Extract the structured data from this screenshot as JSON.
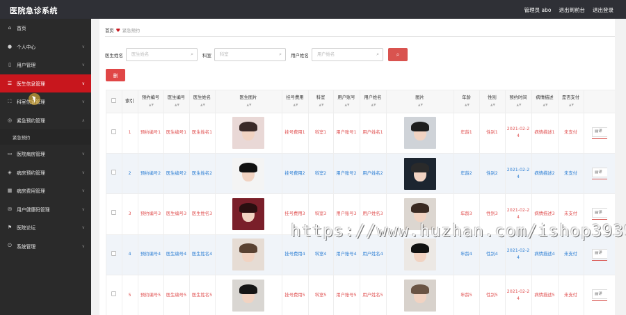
{
  "header": {
    "title": "医院急诊系统",
    "user": "管理员 abo",
    "backstage": "退出到前台",
    "logout": "退出登录"
  },
  "sidebar": {
    "items": [
      {
        "label": "首页",
        "icon": "home-icon"
      },
      {
        "label": "个人中心",
        "icon": "user-icon"
      },
      {
        "label": "用户管理",
        "icon": "phone-icon"
      },
      {
        "label": "医生信息管理",
        "icon": "list-icon"
      },
      {
        "label": "科室信息管理",
        "icon": "expand-icon"
      },
      {
        "label": "紧急预约管理",
        "icon": "compass-icon"
      },
      {
        "label": "医院病房管理",
        "icon": "card-icon"
      },
      {
        "label": "病房预约管理",
        "icon": "tag-icon"
      },
      {
        "label": "病房费用管理",
        "icon": "grid-icon"
      },
      {
        "label": "用户健康码管理",
        "icon": "mail-icon"
      },
      {
        "label": "医院论坛",
        "icon": "flag-icon"
      },
      {
        "label": "系统管理",
        "icon": "power-icon"
      }
    ],
    "sub_item": "紧急预约"
  },
  "breadcrumb": {
    "home": "首页",
    "current": "紧急预约"
  },
  "search": {
    "doctor_label": "医生姓名",
    "doctor_placeholder": "医生姓名",
    "dept_label": "科室",
    "dept_placeholder": "科室",
    "user_label": "用户姓名",
    "user_placeholder": "用户姓名"
  },
  "delete_button": "删",
  "table": {
    "headers": [
      "索引",
      "预约编号",
      "医生编号",
      "医生姓名",
      "医生图片",
      "挂号费用",
      "科室",
      "用户账号",
      "用户姓名",
      "图片",
      "年龄",
      "性别",
      "预约时间",
      "病情描述",
      "是否支付",
      ""
    ],
    "action_label": "详",
    "rows": [
      {
        "index": "1",
        "cells": [
          "预约编号1",
          "医生编号1",
          "医生姓名1",
          "",
          "挂号费用1",
          "科室1",
          "用户账号1",
          "用户姓名1",
          "",
          "年龄1",
          "性别1",
          "2021-02-24",
          "病情描述1",
          "未支付"
        ]
      },
      {
        "index": "2",
        "cells": [
          "预约编号2",
          "医生编号2",
          "医生姓名2",
          "",
          "挂号费用2",
          "科室2",
          "用户账号2",
          "用户姓名2",
          "",
          "年龄2",
          "性别2",
          "2021-02-24",
          "病情描述2",
          "未支付"
        ]
      },
      {
        "index": "3",
        "cells": [
          "预约编号3",
          "医生编号3",
          "医生姓名3",
          "",
          "挂号费用3",
          "科室3",
          "用户账号3",
          "用户姓名3",
          "",
          "年龄3",
          "性别3",
          "2021-02-24",
          "病情描述3",
          "未支付"
        ]
      },
      {
        "index": "4",
        "cells": [
          "预约编号4",
          "医生编号4",
          "医生姓名4",
          "",
          "挂号费用4",
          "科室4",
          "用户账号4",
          "用户姓名4",
          "",
          "年龄4",
          "性别4",
          "2021-02-24",
          "病情描述4",
          "未支付"
        ]
      },
      {
        "index": "5",
        "cells": [
          "预约编号5",
          "医生编号5",
          "医生姓名5",
          "",
          "挂号费用5",
          "科室5",
          "用户账号5",
          "用户姓名5",
          "",
          "年龄5",
          "性别5",
          "2021-02-24",
          "病情描述5",
          "未支付"
        ]
      }
    ]
  },
  "colors": {
    "accent": "#c8161d",
    "link_red": "#e05252",
    "link_blue": "#2e7fd4",
    "header_bg": "#2f3036",
    "sidebar_bg": "#2a2a2a"
  },
  "watermark": "https://www.huzhan.com/ishop39397"
}
